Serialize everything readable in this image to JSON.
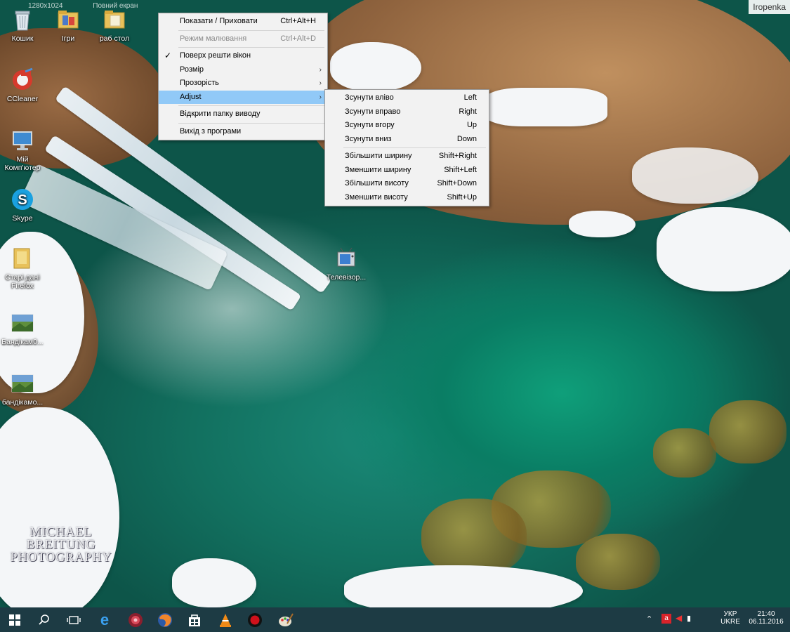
{
  "corner_tag": "Iropenka",
  "top_ghost": [
    "1280x1024",
    "Повний екран"
  ],
  "desktop_icons": [
    {
      "label": "Кошик",
      "icon": "recycle-bin-icon"
    },
    {
      "label": "Ігри",
      "icon": "folder-icon"
    },
    {
      "label": "раб стол",
      "icon": "folder-icon"
    },
    {
      "label": "CCleaner",
      "icon": "ccleaner-icon"
    },
    {
      "label": "Мій Комп'ютер",
      "icon": "computer-icon"
    },
    {
      "label": "Skype",
      "icon": "skype-icon"
    },
    {
      "label": "Старі дані Firefox",
      "icon": "folder-icon"
    },
    {
      "label": "Бандікам0...",
      "icon": "image-file-icon"
    },
    {
      "label": "бандікамо...",
      "icon": "image-file-icon"
    },
    {
      "label": "Телевізор...",
      "icon": "tv-icon"
    }
  ],
  "watermark": [
    "MICHAEL BREITUNG",
    "PHOTOGRAPHY"
  ],
  "context_menu": {
    "items": [
      {
        "label": "Показати / Приховати",
        "shortcut": "Ctrl+Alt+H"
      },
      {
        "label": "Режим малювання",
        "shortcut": "Ctrl+Alt+D"
      },
      {
        "label": "Поверх решти вікон",
        "shortcut": ""
      },
      {
        "label": "Розмір",
        "shortcut": ""
      },
      {
        "label": "Прозорість",
        "shortcut": ""
      },
      {
        "label": "Adjust",
        "shortcut": ""
      },
      {
        "label": "Відкрити папку виводу",
        "shortcut": ""
      },
      {
        "label": "Вихід з програми",
        "shortcut": ""
      }
    ]
  },
  "submenu": {
    "items": [
      {
        "label": "Зсунути вліво",
        "shortcut": "Left"
      },
      {
        "label": "Зсунути вправо",
        "shortcut": "Right"
      },
      {
        "label": "Зсунути вгору",
        "shortcut": "Up"
      },
      {
        "label": "Зсунути вниз",
        "shortcut": "Down"
      },
      {
        "label": "Збільшити ширину",
        "shortcut": "Shift+Right"
      },
      {
        "label": "Зменшити ширину",
        "shortcut": "Shift+Left"
      },
      {
        "label": "Збільшити висоту",
        "shortcut": "Shift+Down"
      },
      {
        "label": "Зменшити висоту",
        "shortcut": "Shift+Up"
      }
    ]
  },
  "taskbar": {
    "pinned": [
      "windows-start-icon",
      "search-icon",
      "task-view-icon",
      "edge-icon",
      "media-player-icon",
      "firefox-icon",
      "store-icon",
      "vlc-icon",
      "record-icon",
      "paint-icon"
    ],
    "tray": {
      "lang_top": "УКР",
      "lang_bottom": "UKRE",
      "time": "21:40",
      "date": "06.11.2016"
    }
  },
  "colors": {
    "menu_bg": "#f2f2f2",
    "menu_highlight": "#91c9f7",
    "taskbar_bg": "#1d3b44"
  }
}
